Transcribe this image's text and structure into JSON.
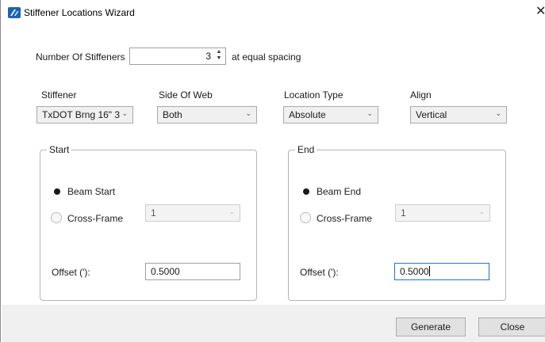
{
  "window": {
    "title": "Stiffener Locations Wizard",
    "close_glyph": "✕"
  },
  "stiffeners": {
    "label": "Number Of Stiffeners",
    "value": "3",
    "suffix": "at equal spacing"
  },
  "fields": {
    "stiffener": {
      "label": "Stiffener",
      "value": "TxDOT Brng 16\" 3"
    },
    "side_of_web": {
      "label": "Side Of Web",
      "value": "Both"
    },
    "location_type": {
      "label": "Location Type",
      "value": "Absolute"
    },
    "align": {
      "label": "Align",
      "value": "Vertical"
    }
  },
  "start_group": {
    "legend": "Start",
    "radio_beam": "Beam Start",
    "radio_cross": "Cross-Frame",
    "cross_value": "1",
    "offset_label": "Offset ('):",
    "offset_value": "0.5000"
  },
  "end_group": {
    "legend": "End",
    "radio_beam": "Beam End",
    "radio_cross": "Cross-Frame",
    "cross_value": "1",
    "offset_label": "Offset ('):",
    "offset_value": "0.5000"
  },
  "buttons": {
    "generate": "Generate",
    "close": "Close"
  },
  "colors": {
    "accent_blue": "#1e6fd9",
    "footer_bg": "#f0f0f0",
    "icon_blue": "#1b63b8"
  },
  "icons": [
    "app-logo-icon",
    "close-icon",
    "spin-up-icon",
    "spin-down-icon",
    "chevron-down-icon"
  ]
}
